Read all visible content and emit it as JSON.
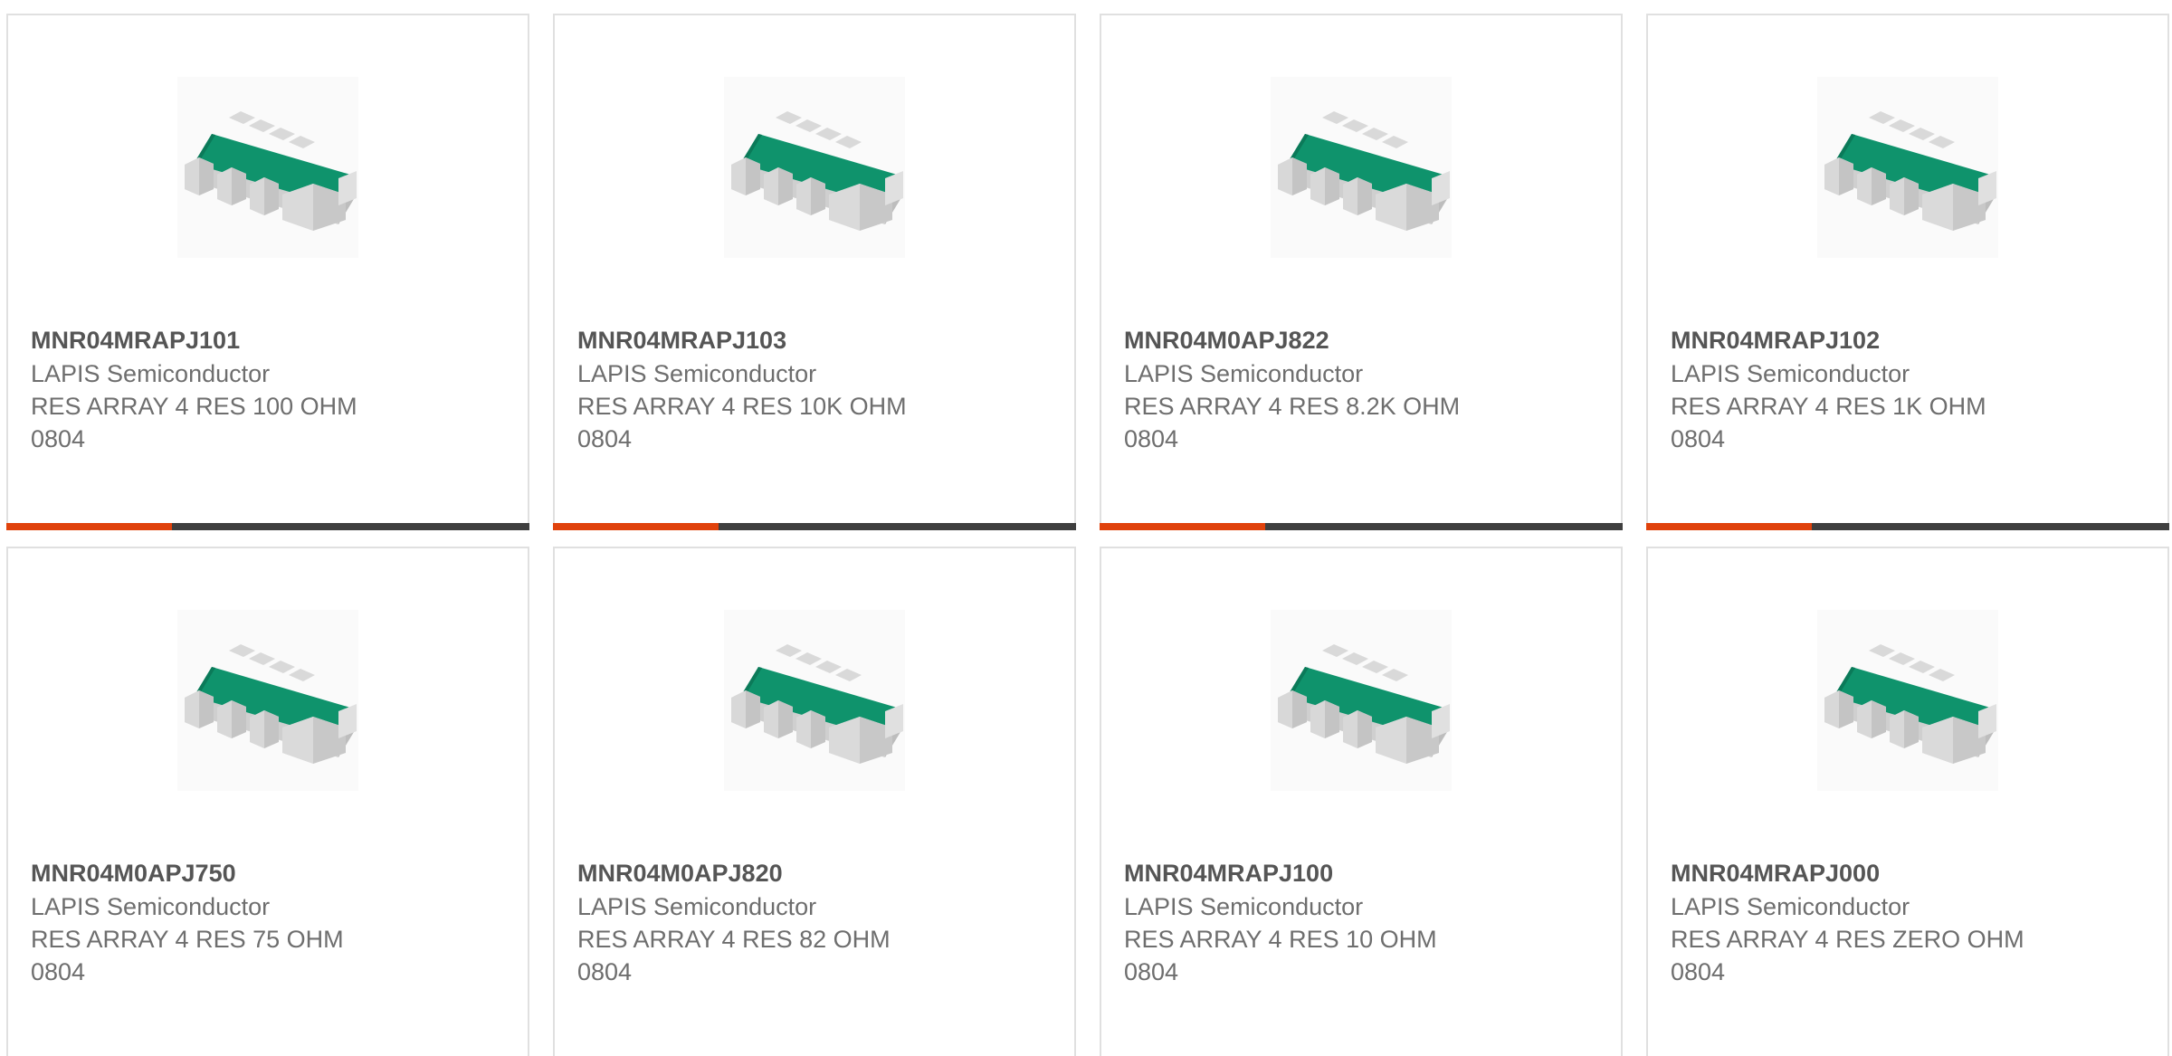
{
  "colors": {
    "accent": "#e0420c",
    "bar_track": "#3f3f3f",
    "body_green": "#10926b",
    "terminal_grey": "#d6d6d6"
  },
  "products": [
    {
      "part": "MNR04MRAPJ101",
      "maker": "LAPIS Semiconductor",
      "desc": "RES ARRAY 4 RES 100 OHM",
      "size": "0804",
      "image_icon": "resistor-array-chip-icon"
    },
    {
      "part": "MNR04MRAPJ103",
      "maker": "LAPIS Semiconductor",
      "desc": "RES ARRAY 4 RES 10K OHM",
      "size": "0804",
      "image_icon": "resistor-array-chip-icon"
    },
    {
      "part": "MNR04M0APJ822",
      "maker": "LAPIS Semiconductor",
      "desc": "RES ARRAY 4 RES 8.2K OHM",
      "size": "0804",
      "image_icon": "resistor-array-chip-icon"
    },
    {
      "part": "MNR04MRAPJ102",
      "maker": "LAPIS Semiconductor",
      "desc": "RES ARRAY 4 RES 1K OHM",
      "size": "0804",
      "image_icon": "resistor-array-chip-icon"
    },
    {
      "part": "MNR04M0APJ750",
      "maker": "LAPIS Semiconductor",
      "desc": "RES ARRAY 4 RES 75 OHM",
      "size": "0804",
      "image_icon": "resistor-array-chip-icon"
    },
    {
      "part": "MNR04M0APJ820",
      "maker": "LAPIS Semiconductor",
      "desc": "RES ARRAY 4 RES 82 OHM",
      "size": "0804",
      "image_icon": "resistor-array-chip-icon"
    },
    {
      "part": "MNR04MRAPJ100",
      "maker": "LAPIS Semiconductor",
      "desc": "RES ARRAY 4 RES 10 OHM",
      "size": "0804",
      "image_icon": "resistor-array-chip-icon"
    },
    {
      "part": "MNR04MRAPJ000",
      "maker": "LAPIS Semiconductor",
      "desc": "RES ARRAY 4 RES ZERO OHM",
      "size": "0804",
      "image_icon": "resistor-array-chip-icon"
    }
  ]
}
